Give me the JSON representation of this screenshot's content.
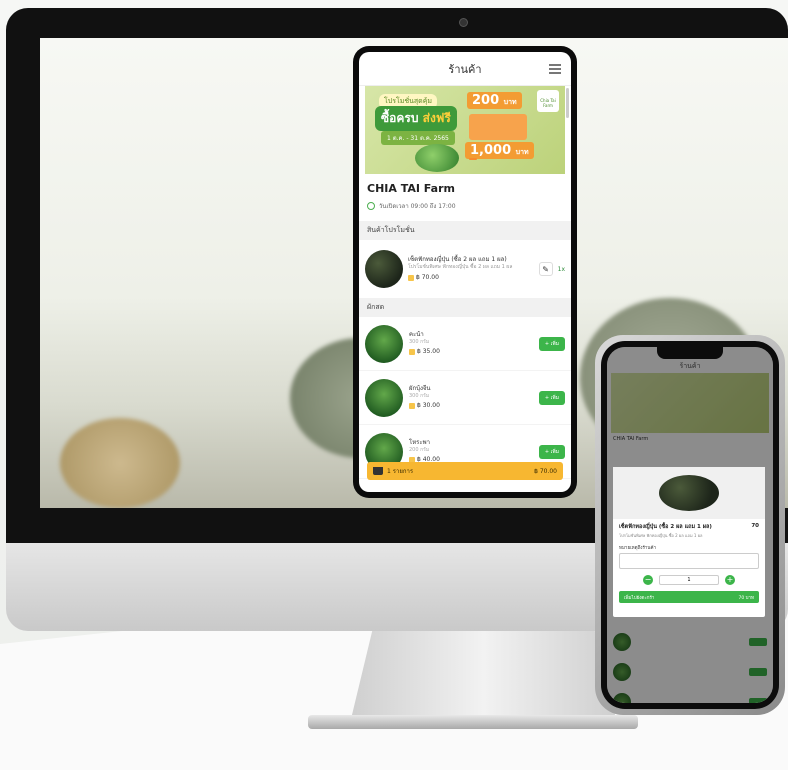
{
  "tablet": {
    "title": "ร้านค้า",
    "banner": {
      "tag": "โปรโมชั่นสุดคุ้ม",
      "headline": "ซื้อครบ",
      "headline_accent": "ส่งฟรี",
      "date": "1 ต.ค. - 31 ต.ค. 2565",
      "price1": "200",
      "price1_unit": "บาท",
      "price2": "1,000",
      "price2_unit": "บาท",
      "logo": "Chia Tai Farm"
    },
    "shop_name": "CHIA TAI Farm",
    "hours": "วันเปิดเวลา 09:00 ถึง 17:00",
    "section_featured": "สินค้าโปรโมชั่น",
    "featured": {
      "name": "เซ็ตฟักทองญี่ปุ่น (ซื้อ 2 ผล แถม 1 ผล)",
      "desc": "โปรโมชั่นพิเศษ ฟักทองญี่ปุ่น ซื้อ 2 ผล แถม 1 ผล",
      "price": "฿ 70.00",
      "qty": "1x"
    },
    "section_fresh": "ผักสด",
    "items": [
      {
        "name": "คะน้า",
        "weight": "300 กรัม",
        "price": "฿ 35.00",
        "add": "+ เพิ่ม"
      },
      {
        "name": "ผักบุ้งจีน",
        "weight": "300 กรัม",
        "price": "฿ 30.00",
        "add": "+ เพิ่ม"
      },
      {
        "name": "โหระพา",
        "weight": "200 กรัม",
        "price": "฿ 40.00",
        "add": "+ เพิ่ม"
      }
    ],
    "cart": {
      "count": "1 รายการ",
      "total": "฿ 70.00"
    }
  },
  "phone": {
    "title": "ร้านค้า",
    "shop_name": "CHIA TAI Farm",
    "modal": {
      "name": "เซ็ตฟักทองญี่ปุ่น (ซื้อ 2 ผล แถม 1 ผล)",
      "price": "70",
      "desc": "โปรโมชั่นพิเศษ ฟักทองญี่ปุ่น ซื้อ 2 ผล แถม 1 ผล",
      "note_label": "หมายเหตุถึงร้านค้า",
      "qty": "1",
      "add_label": "เพิ่มไปยังตะกร้า",
      "add_total": "70 บาท"
    }
  }
}
